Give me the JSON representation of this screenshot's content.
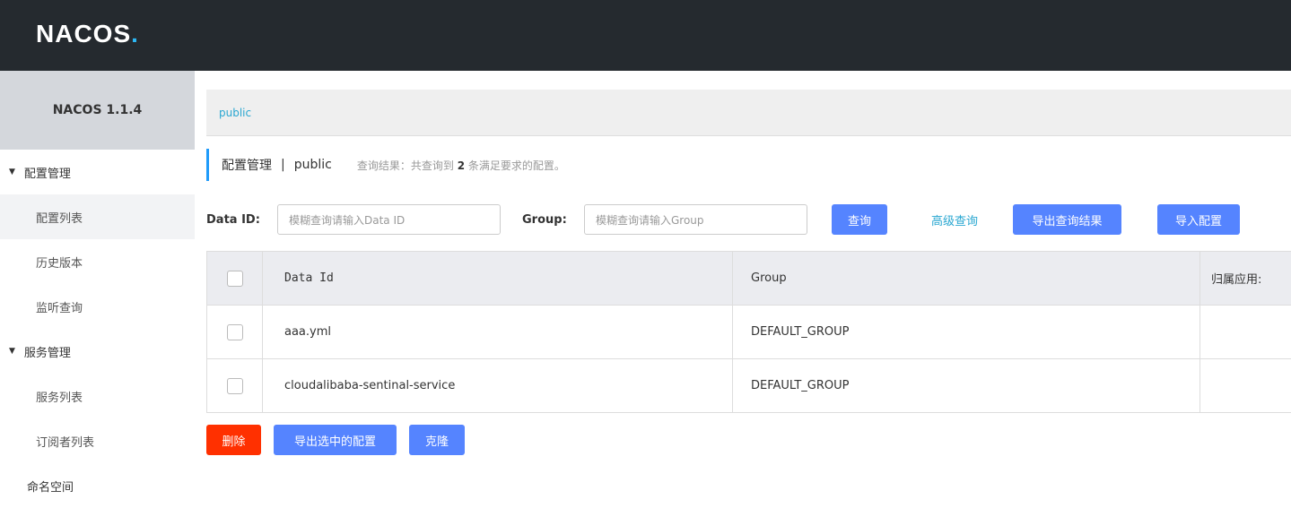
{
  "header": {
    "logo_text": "NACOS",
    "logo_dot": "."
  },
  "sidebar": {
    "version": "NACOS 1.1.4",
    "groups": [
      {
        "label": "配置管理",
        "items": [
          "配置列表",
          "历史版本",
          "监听查询"
        ]
      },
      {
        "label": "服务管理",
        "items": [
          "服务列表",
          "订阅者列表"
        ]
      }
    ],
    "namespace": "命名空间"
  },
  "breadcrumb": {
    "namespace": "public"
  },
  "title": {
    "main": "配置管理",
    "sep": "|",
    "namespace": "public",
    "summary_prefix": "查询结果：共查询到",
    "summary_count": "2",
    "summary_suffix": "条满足要求的配置。"
  },
  "search": {
    "dataid_label": "Data ID:",
    "dataid_placeholder": "模糊查询请输入Data ID",
    "group_label": "Group:",
    "group_placeholder": "模糊查询请输入Group",
    "query_button": "查询",
    "advanced_link": "高级查询",
    "export_button": "导出查询结果",
    "import_button": "导入配置"
  },
  "table": {
    "headers": [
      "Data Id",
      "Group",
      "归属应用:"
    ],
    "rows": [
      {
        "data_id": "aaa.yml",
        "group": "DEFAULT_GROUP",
        "app": ""
      },
      {
        "data_id": "cloudalibaba-sentinal-service",
        "group": "DEFAULT_GROUP",
        "app": ""
      }
    ]
  },
  "actions": {
    "delete": "删除",
    "export_selected": "导出选中的配置",
    "clone": "克隆"
  },
  "colors": {
    "topbar": "#252a2f",
    "primary": "#5584ff",
    "danger": "#ff3000",
    "link": "#2aa7d1"
  }
}
